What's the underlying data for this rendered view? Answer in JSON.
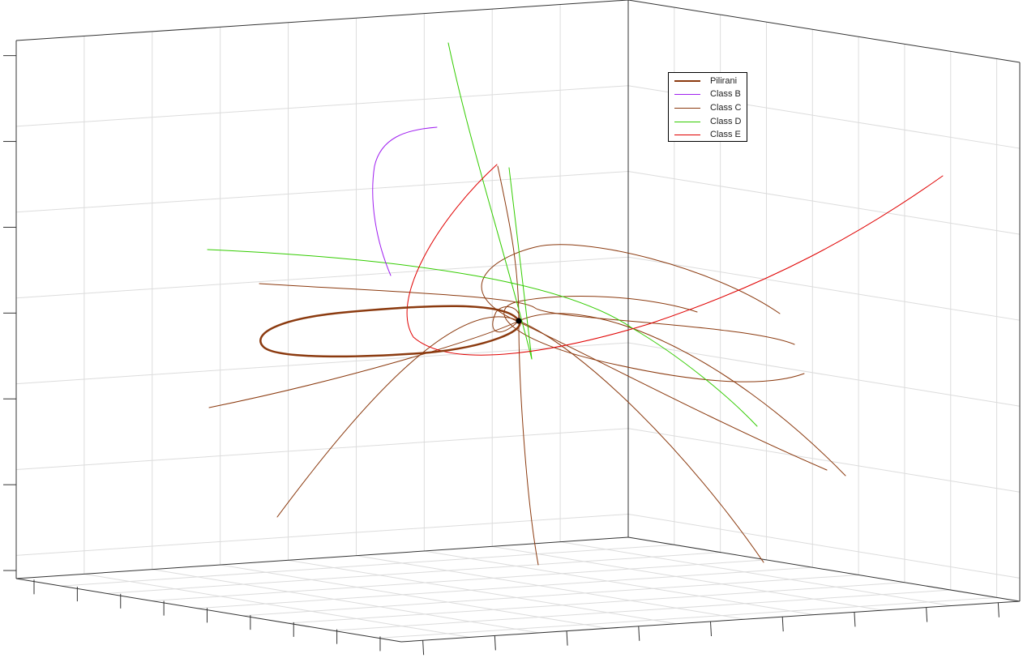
{
  "chart_data": {
    "type": "line",
    "title": "",
    "view": "3d",
    "grid": true,
    "legend_position": "top-right",
    "series": [
      {
        "name": "Pilirani",
        "color": "#8B3A0F",
        "width": 2.5
      },
      {
        "name": "Class B",
        "color": "#A020F0",
        "width": 1
      },
      {
        "name": "Class C",
        "color": "#8B3A0F",
        "width": 1
      },
      {
        "name": "Class D",
        "color": "#33CC00",
        "width": 1
      },
      {
        "name": "Class E",
        "color": "#E00000",
        "width": 1
      }
    ]
  }
}
